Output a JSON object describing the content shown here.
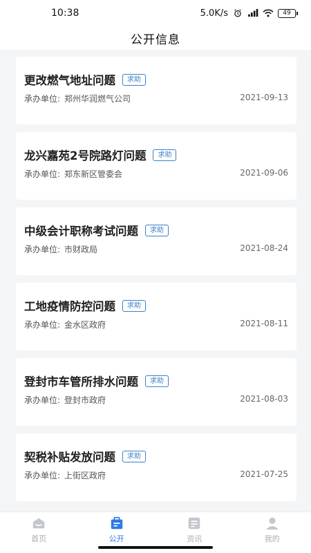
{
  "status_bar": {
    "time": "10:38",
    "speed": "5.0K/s",
    "battery": "49"
  },
  "header": {
    "title": "公开信息"
  },
  "list": {
    "meta_label": "承办单位:",
    "items": [
      {
        "title": "更改燃气地址问题",
        "tag": "求助",
        "org": "郑州华润燃气公司",
        "date": "2021-09-13"
      },
      {
        "title": "龙兴嘉苑2号院路灯问题",
        "tag": "求助",
        "org": "郑东新区管委会",
        "date": "2021-09-06"
      },
      {
        "title": "中级会计职称考试问题",
        "tag": "求助",
        "org": "市财政局",
        "date": "2021-08-24"
      },
      {
        "title": "工地疫情防控问题",
        "tag": "求助",
        "org": "金水区政府",
        "date": "2021-08-11"
      },
      {
        "title": "登封市车管所排水问题",
        "tag": "求助",
        "org": "登封市政府",
        "date": "2021-08-03"
      },
      {
        "title": "契税补贴发放问题",
        "tag": "求助",
        "org": "上街区政府",
        "date": "2021-07-25"
      }
    ]
  },
  "tabs": [
    {
      "label": "首页",
      "icon": "home-icon",
      "active": false
    },
    {
      "label": "公开",
      "icon": "briefcase-icon",
      "active": true
    },
    {
      "label": "资讯",
      "icon": "news-icon",
      "active": false
    },
    {
      "label": "我的",
      "icon": "user-icon",
      "active": false
    }
  ],
  "colors": {
    "accent": "#2f7ae5",
    "tag": "#3b7fc4",
    "inactive": "#a8adb5"
  }
}
